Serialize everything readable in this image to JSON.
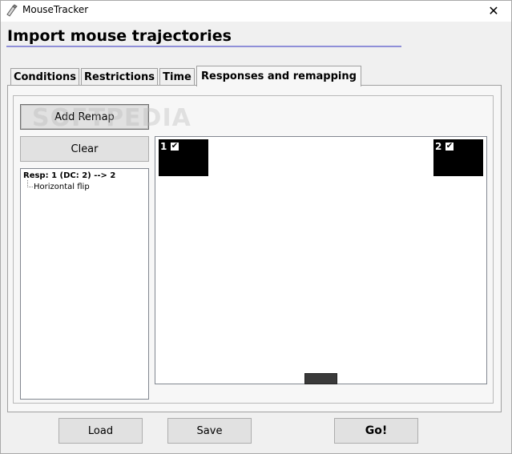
{
  "window": {
    "title": "MouseTracker",
    "close_glyph": "✕"
  },
  "header": {
    "title": "Import mouse trajectories"
  },
  "tabs": [
    {
      "label": "Conditions"
    },
    {
      "label": "Restrictions"
    },
    {
      "label": "Time"
    },
    {
      "label": "Responses and remapping"
    }
  ],
  "panel": {
    "add_remap_label": "Add Remap",
    "clear_label": "Clear",
    "tree": {
      "root": "Resp: 1 (DC: 2) --> 2",
      "child": "Horizontal flip"
    },
    "responses": [
      {
        "number": "1",
        "checked": "✔"
      },
      {
        "number": "2",
        "checked": "✔"
      }
    ],
    "watermark": "SOFTPEDIA"
  },
  "footer": {
    "load_label": "Load",
    "save_label": "Save",
    "go_label": "Go!"
  }
}
